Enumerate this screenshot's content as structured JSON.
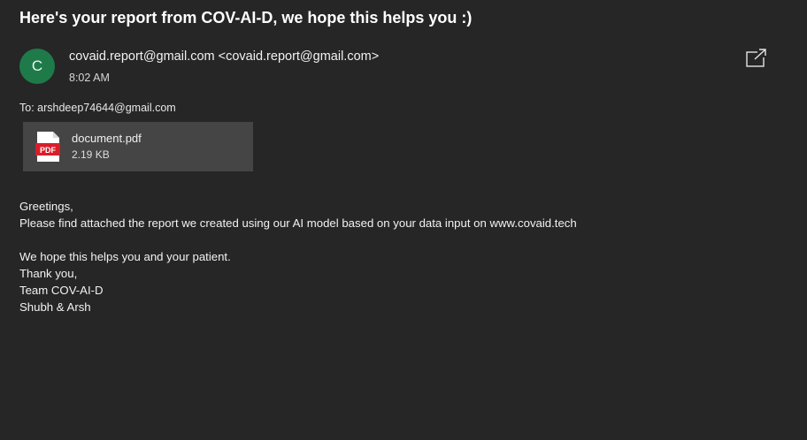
{
  "email": {
    "subject": "Here's your report from COV-AI-D, we hope this helps you :)",
    "sender": {
      "avatar_initial": "C",
      "display": "covaid.report@gmail.com <covaid.report@gmail.com>",
      "time": "8:02 AM"
    },
    "to": "To: arshdeep74644@gmail.com",
    "attachment": {
      "icon_label": "PDF",
      "name": "document.pdf",
      "size": "2.19 KB"
    },
    "body": [
      "Greetings,",
      "Please find attached the report we created using our AI model based on your data input on www.covaid.tech",
      "",
      "We hope this helps you and your patient.",
      "Thank you,",
      "Team COV-AI-D",
      "Shubh & Arsh"
    ]
  },
  "icons": {
    "popout": "open-in-new-window-icon",
    "pdf": "pdf-file-icon"
  },
  "colors": {
    "background": "#262626",
    "avatar": "#1f7a4a",
    "attachment_bg": "#454545",
    "pdf_red": "#d81e2a"
  }
}
